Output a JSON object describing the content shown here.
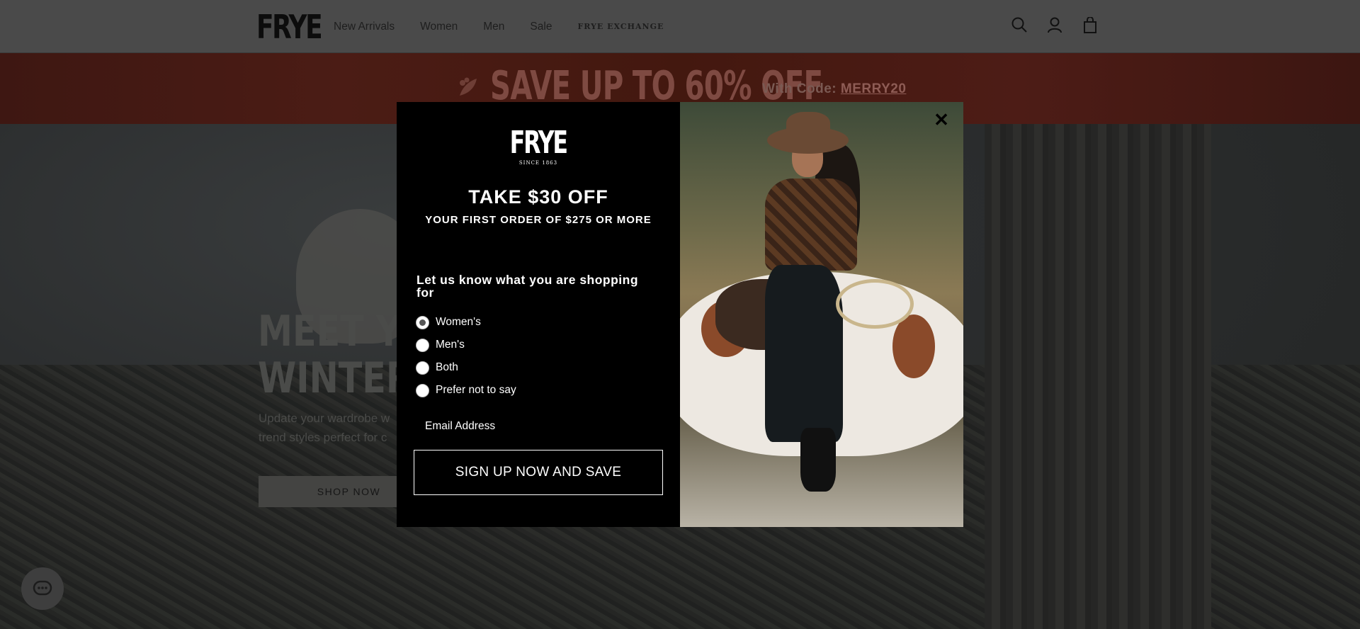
{
  "header": {
    "logo": "FRYE",
    "nav": [
      {
        "label": "New Arrivals"
      },
      {
        "label": "Women"
      },
      {
        "label": "Men"
      },
      {
        "label": "Sale"
      },
      {
        "label": "FRYE EXCHANGE"
      }
    ],
    "icons": [
      "search-icon",
      "account-icon",
      "cart-icon"
    ]
  },
  "promo": {
    "headline": "SAVE UP TO 60% OFF",
    "code_prefix": "With Code:",
    "code": "MERRY20"
  },
  "hero": {
    "title_line1": "MEET YOU",
    "title_line2": "WINTER F",
    "subtitle_line1": "Update your wardrobe w",
    "subtitle_line2": "trend styles perfect for c",
    "button": "SHOP NOW"
  },
  "modal": {
    "logo": "FRYE",
    "since": "SINCE 1863",
    "headline": "TAKE $30 OFF",
    "subheadline": "YOUR FIRST ORDER OF $275 OR MORE",
    "question": "Let us know what you are shopping for",
    "options": [
      {
        "label": "Women's",
        "checked": true
      },
      {
        "label": "Men's",
        "checked": false
      },
      {
        "label": "Both",
        "checked": false
      },
      {
        "label": "Prefer not to say",
        "checked": false
      }
    ],
    "email_placeholder": "Email Address",
    "submit": "SIGN UP NOW AND SAVE",
    "close": "✕"
  },
  "colors": {
    "header_bg": "#4a4a4a",
    "promo_bg": "#4b1c15",
    "modal_bg": "#000000",
    "modal_text": "#ffffff"
  }
}
